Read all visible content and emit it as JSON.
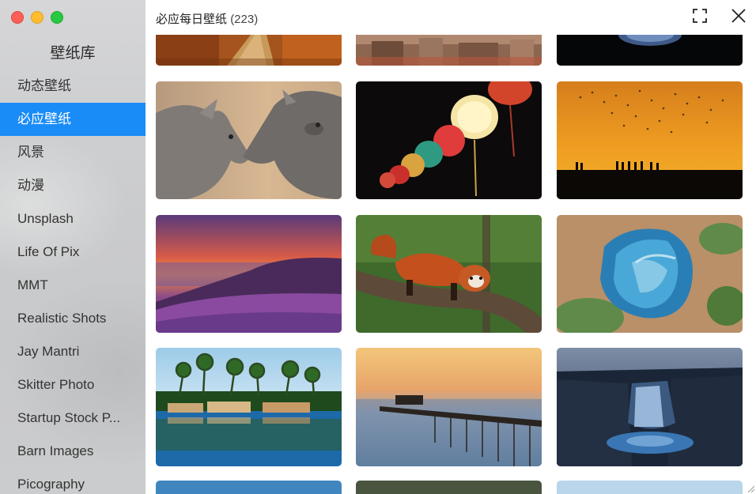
{
  "window": {
    "controls": [
      "close",
      "minimize",
      "maximize"
    ]
  },
  "sidebar": {
    "title": "壁纸库",
    "items": [
      {
        "label": "动态壁纸",
        "active": false
      },
      {
        "label": "必应壁纸",
        "active": true
      },
      {
        "label": "风景",
        "active": false
      },
      {
        "label": "动漫",
        "active": false
      },
      {
        "label": "Unsplash",
        "active": false
      },
      {
        "label": "Life Of Pix",
        "active": false
      },
      {
        "label": "MMT",
        "active": false
      },
      {
        "label": "Realistic Shots",
        "active": false
      },
      {
        "label": "Jay Mantri",
        "active": false
      },
      {
        "label": "Skitter Photo",
        "active": false
      },
      {
        "label": "Startup Stock P...",
        "active": false
      },
      {
        "label": "Barn Images",
        "active": false
      },
      {
        "label": "Picography",
        "active": false
      }
    ]
  },
  "header": {
    "title": "必应每日壁纸",
    "count": "(223)",
    "icons": [
      "fullscreen-icon",
      "close-icon"
    ]
  },
  "colors": {
    "accent": "#1a8cf7",
    "sidebar_bg": "#cbcccd",
    "text": "#222222"
  },
  "gallery": {
    "tiles": [
      {
        "row": 0,
        "col": 0,
        "subject": "autumn-path"
      },
      {
        "row": 0,
        "col": 1,
        "subject": "old-town-rooftops"
      },
      {
        "row": 0,
        "col": 2,
        "subject": "planet-dark-sky"
      },
      {
        "row": 1,
        "col": 0,
        "subject": "rhinos"
      },
      {
        "row": 1,
        "col": 1,
        "subject": "chinese-lanterns"
      },
      {
        "row": 1,
        "col": 2,
        "subject": "birds-sunset-silhouettes"
      },
      {
        "row": 2,
        "col": 0,
        "subject": "purple-coast-sunset"
      },
      {
        "row": 2,
        "col": 1,
        "subject": "red-panda"
      },
      {
        "row": 2,
        "col": 2,
        "subject": "aerial-blue-pool"
      },
      {
        "row": 3,
        "col": 0,
        "subject": "palm-houseboats"
      },
      {
        "row": 3,
        "col": 1,
        "subject": "pier-sunset"
      },
      {
        "row": 3,
        "col": 2,
        "subject": "waterfall-dusk"
      },
      {
        "row": 4,
        "col": 0,
        "subject": "partial-next"
      },
      {
        "row": 4,
        "col": 1,
        "subject": "partial-next"
      },
      {
        "row": 4,
        "col": 2,
        "subject": "partial-next"
      }
    ]
  }
}
